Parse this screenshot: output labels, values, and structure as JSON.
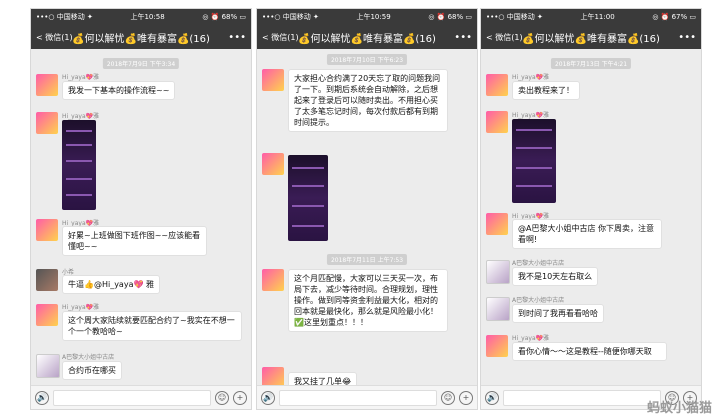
{
  "phones": [
    {
      "status": {
        "carrier": "•••○ 中国移动 ✦",
        "time": "上午10:58",
        "right": "◎ ⏰ 68% ▭"
      },
      "nav": {
        "back": "< 微信(1)",
        "title": "💰何以解忧💰唯有暴富💰(16)",
        "menu": "•••"
      },
      "timestamp": "2018年7月9日 下午3:34",
      "messages": [
        {
          "sender": "Hi_yaya💖雅",
          "text": "我发一下基本的操作流程~~"
        },
        {
          "sender": "Hi_yaya💖雅"
        },
        {
          "sender": "Hi_yaya💖雅",
          "text": "好累~上班做图下班作图~~应该能看懂吧~~"
        },
        {
          "sender": "小希",
          "text": "牛逼👍@Hi_yaya💖 雅"
        },
        {
          "sender": "Hi_yaya💖雅",
          "text": "这个周大家陆续就要匹配合约了~我实在不想一个一个教哈哈~"
        },
        {
          "sender": "A巴黎大小姐中古店",
          "text": "合约币在哪买"
        }
      ]
    },
    {
      "status": {
        "carrier": "•••○ 中国移动 ✦",
        "time": "上午10:59",
        "right": "◎ ⏰ 68% ▭"
      },
      "nav": {
        "back": "< 微信(1)",
        "title": "💰何以解忧💰唯有暴富💰(16)",
        "menu": "•••"
      },
      "timestamps": [
        "2018年7月10日 下午6:23",
        "2018年7月11日 上午7:53"
      ],
      "messages": [
        {
          "text": "大家担心合约满了20天忘了取的问题我问了一下。到期后系统会自动解除，之后想起来了登录后可以随时卖出。不用担心买了太多笔忘记时间，每次付款后都有到期时间提示。"
        },
        {},
        {
          "text": "这个月匹配慢，大家可以三天买一次，布局下去，减少等待时间。合理规划，理性操作。做到同等资金利益最大化，相对的回本就是最快化，那么就是风险最小化！✅这里划重点！！！"
        },
        {
          "text": "我又挂了几单😂"
        }
      ]
    },
    {
      "status": {
        "carrier": "•••○ 中国移动 ✦",
        "time": "上午11:00",
        "right": "◎ ⏰ 67% ▭"
      },
      "nav": {
        "back": "< 微信(1)",
        "title": "💰何以解忧💰唯有暴富💰(16)",
        "menu": "•••"
      },
      "timestamp": "2018年7月13日 下午4:21",
      "messages": [
        {
          "sender": "Hi_yaya💖雅",
          "text": "卖出教程来了！"
        },
        {
          "sender": "Hi_yaya💖雅"
        },
        {
          "sender": "Hi_yaya💖雅",
          "text": "@A巴黎大小姐中古店 你下周卖，注意看啊!"
        },
        {
          "sender": "A巴黎大小姐中古店",
          "text": "我不是10天左右取么"
        },
        {
          "sender": "A巴黎大小姐中古店",
          "text": "到时间了我再看看哈哈"
        },
        {
          "sender": "Hi_yaya💖雅",
          "text": "看你心情～～这是教程--随便你哪天取"
        }
      ]
    }
  ],
  "input": {
    "voice": "🔊",
    "emoji": "☺",
    "plus": "+"
  },
  "watermark": "蚂蚁小猫猫"
}
